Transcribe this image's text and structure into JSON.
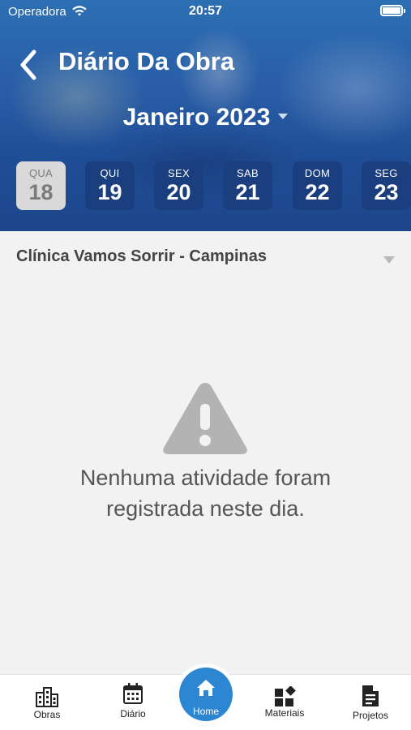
{
  "status_bar": {
    "carrier": "Operadora",
    "time": "20:57"
  },
  "header": {
    "title": "Diário Da Obra",
    "month": "Janeiro 2023"
  },
  "days": [
    {
      "name": "QUA",
      "number": "18",
      "selected": true
    },
    {
      "name": "QUI",
      "number": "19",
      "selected": false
    },
    {
      "name": "SEX",
      "number": "20",
      "selected": false
    },
    {
      "name": "SAB",
      "number": "21",
      "selected": false
    },
    {
      "name": "DOM",
      "number": "22",
      "selected": false
    },
    {
      "name": "SEG",
      "number": "23",
      "selected": false
    }
  ],
  "site": {
    "selected": "Clínica Vamos Sorrir - Campinas"
  },
  "empty_state": {
    "line1": "Nenhuma atividade foram",
    "line2": "registrada neste dia."
  },
  "bottom_nav": {
    "obras": "Obras",
    "diario": "Diário",
    "home": "Home",
    "materiais": "Materiais",
    "projetos": "Projetos"
  },
  "colors": {
    "header_blue": "#1f4d95",
    "day_tile": "#1b3f7e",
    "home_accent": "#2d86d1",
    "warning_gray": "#b3b3b3"
  }
}
